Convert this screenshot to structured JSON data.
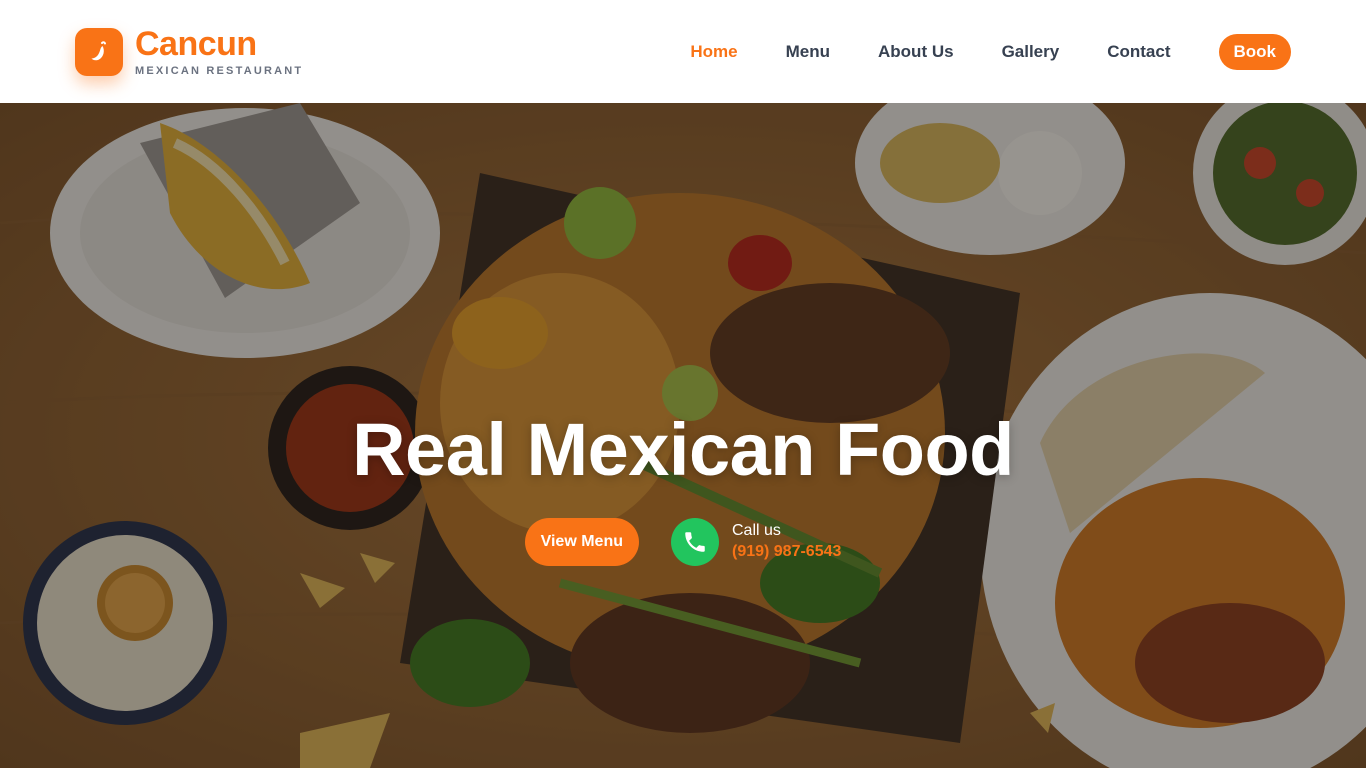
{
  "brand": {
    "name": "Cancun",
    "subtitle": "MEXICAN RESTAURANT",
    "logo_icon": "chili-pepper-icon"
  },
  "nav": {
    "items": [
      {
        "label": "Home",
        "active": true
      },
      {
        "label": "Menu",
        "active": false
      },
      {
        "label": "About Us",
        "active": false
      },
      {
        "label": "Gallery",
        "active": false
      },
      {
        "label": "Contact",
        "active": false
      }
    ],
    "book_label": "Book"
  },
  "hero": {
    "title": "Real Mexican Food",
    "view_menu_label": "View Menu",
    "call_label": "Call us",
    "phone_number": "(919) 987-6543",
    "phone_icon": "phone-icon"
  },
  "colors": {
    "accent": "#f97316",
    "call_green": "#22c55e",
    "nav_text": "#374151",
    "subtitle_gray": "#6b7280"
  }
}
